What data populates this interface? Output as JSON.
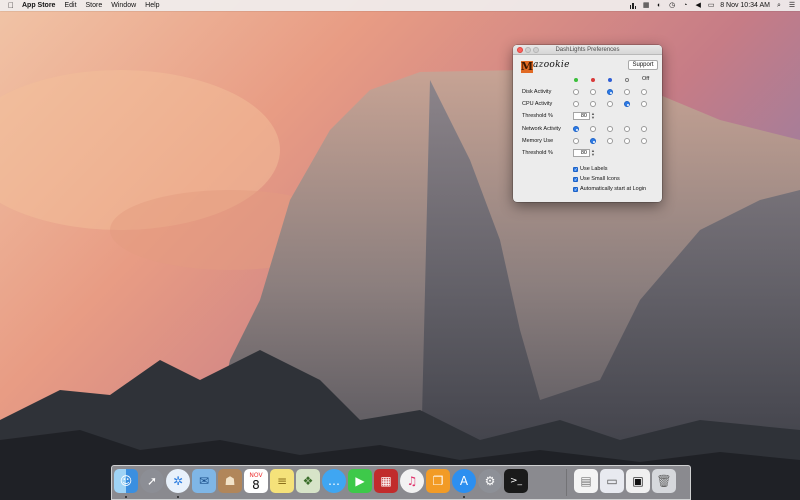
{
  "menubar": {
    "app_name": "App Store",
    "menus": [
      "Edit",
      "Store",
      "Window",
      "Help"
    ],
    "clock": "8 Nov  10:34 AM"
  },
  "window": {
    "title": "DashLights Preferences",
    "logo_text": "azookie",
    "logo_letter": "M",
    "support_label": "Support",
    "off_label": "Off",
    "color_dots": [
      "#3bbf3b",
      "#d93a3a",
      "#2f5fd6",
      "#8a8a8a"
    ],
    "rows": [
      {
        "label": "Disk Activity",
        "selected": 2
      },
      {
        "label": "CPU Activity",
        "selected": 3
      },
      {
        "label": "Network Activity",
        "selected": 0
      },
      {
        "label": "Memory Use",
        "selected": 1
      }
    ],
    "threshold_label": "Threshold %",
    "threshold_cpu": "80",
    "threshold_memory": "80",
    "checkboxes": [
      {
        "label": "Use Labels",
        "checked": true
      },
      {
        "label": "Use Small Icons",
        "checked": true
      },
      {
        "label": "Automatically start at Login",
        "checked": true
      }
    ]
  },
  "dock": {
    "icons": [
      "finder-icon",
      "launchpad-icon",
      "safari-icon",
      "mail-icon",
      "contacts-icon",
      "calendar-icon",
      "notes-icon",
      "preview-icon",
      "messages-icon",
      "facetime-icon",
      "photo-booth-icon",
      "itunes-icon",
      "ibooks-icon",
      "app-store-icon",
      "system-preferences-icon",
      "terminal-icon",
      "document-icon",
      "screenshot-icon",
      "app-window-icon",
      "trash-icon"
    ],
    "calendar_month": "NOV",
    "calendar_day": "8"
  }
}
